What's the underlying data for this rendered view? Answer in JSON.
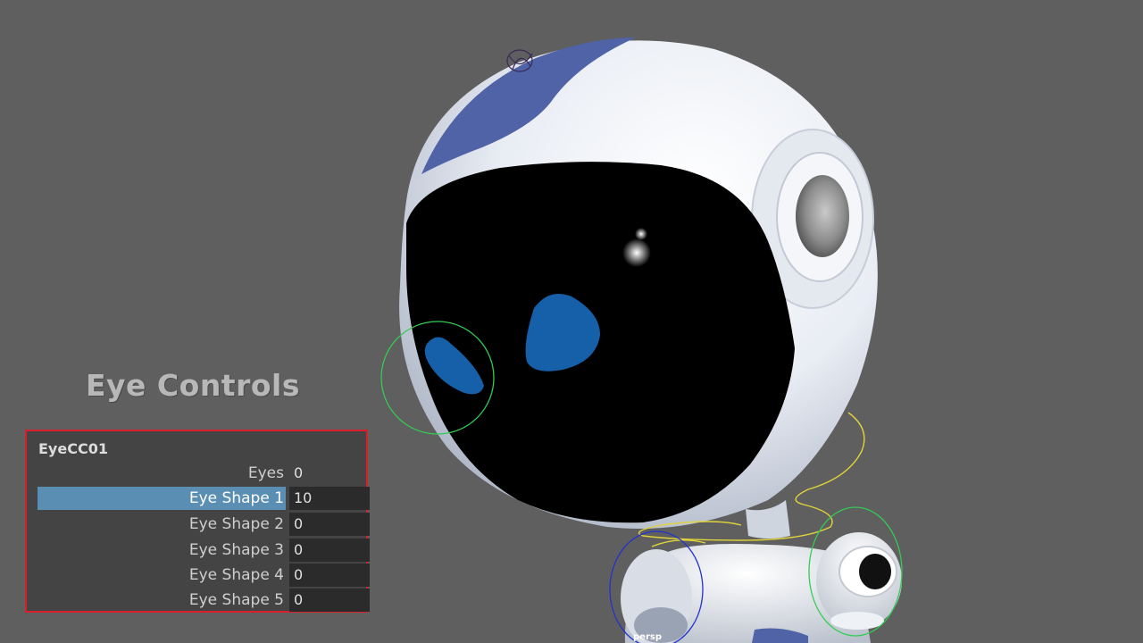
{
  "overlay_title": "Eye Controls",
  "channel_box": {
    "object_name": "EyeCC01",
    "attributes": [
      {
        "label": "Eyes",
        "value": "0"
      },
      {
        "label": "Eye Shape 1",
        "value": "10",
        "selected": true
      },
      {
        "label": "Eye Shape 2",
        "value": "0"
      },
      {
        "label": "Eye Shape 3",
        "value": "0"
      },
      {
        "label": "Eye Shape 4",
        "value": "0"
      },
      {
        "label": "Eye Shape 5",
        "value": "0"
      }
    ]
  },
  "camera_label": "persp",
  "colors": {
    "viewport_bg": "#5f5f5f",
    "panel_border": "#d9202a",
    "selection": "#5a8eb3",
    "eye": "#1560a8",
    "helmet_accent": "#4f63a6"
  }
}
